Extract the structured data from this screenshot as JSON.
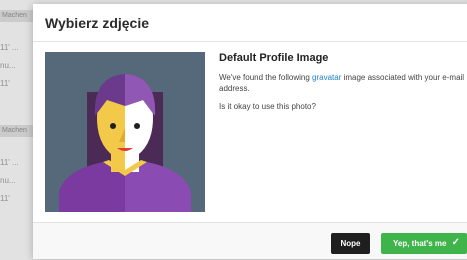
{
  "background": {
    "items": [
      {
        "tag": "Machen"
      },
      {
        "text": "11' ..."
      },
      {
        "text": "nu..."
      },
      {
        "text": "11'"
      },
      {
        "tag": "Machen"
      },
      {
        "text": "11' ..."
      },
      {
        "text": "nu..."
      },
      {
        "text": "11'"
      }
    ]
  },
  "modal": {
    "title": "Wybierz zdjęcie",
    "heading": "Default Profile Image",
    "text_before_link": "We've found the following ",
    "link_text": "gravatar",
    "text_after_link": " image associated with your e-mail address.",
    "question": "Is it okay to use this photo?",
    "buttons": {
      "nope": "Nope",
      "yes": "Yep, that's me",
      "yes_icon": "check-icon"
    },
    "colors": {
      "link": "#1f83c6",
      "confirm": "#3fb44a",
      "reject": "#1f1f1f",
      "avatar_bg": "#55697a"
    }
  }
}
